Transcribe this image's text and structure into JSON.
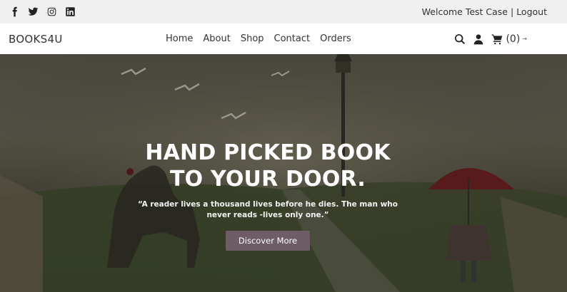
{
  "topbar": {
    "social_icons": [
      "facebook-icon",
      "twitter-icon",
      "instagram-icon",
      "linkedin-icon"
    ],
    "welcome_text": "Welcome Test Case",
    "separator": "|",
    "logout_label": "Logout"
  },
  "navbar": {
    "brand": "BOOKS4U",
    "links": [
      "Home",
      "About",
      "Shop",
      "Contact",
      "Orders"
    ],
    "cart_count": "(0)",
    "cart_arrow": "→"
  },
  "hero": {
    "title_line1": "HAND PICKED BOOK",
    "title_line2": "TO YOUR DOOR.",
    "quote": "“A reader lives a thousand lives before he dies. The man who never reads -lives only one.”",
    "button_label": "Discover More"
  },
  "colors": {
    "topbar_bg": "#f0f0f0",
    "button_bg": "#6e5d66",
    "hero_text": "#ffffff"
  }
}
